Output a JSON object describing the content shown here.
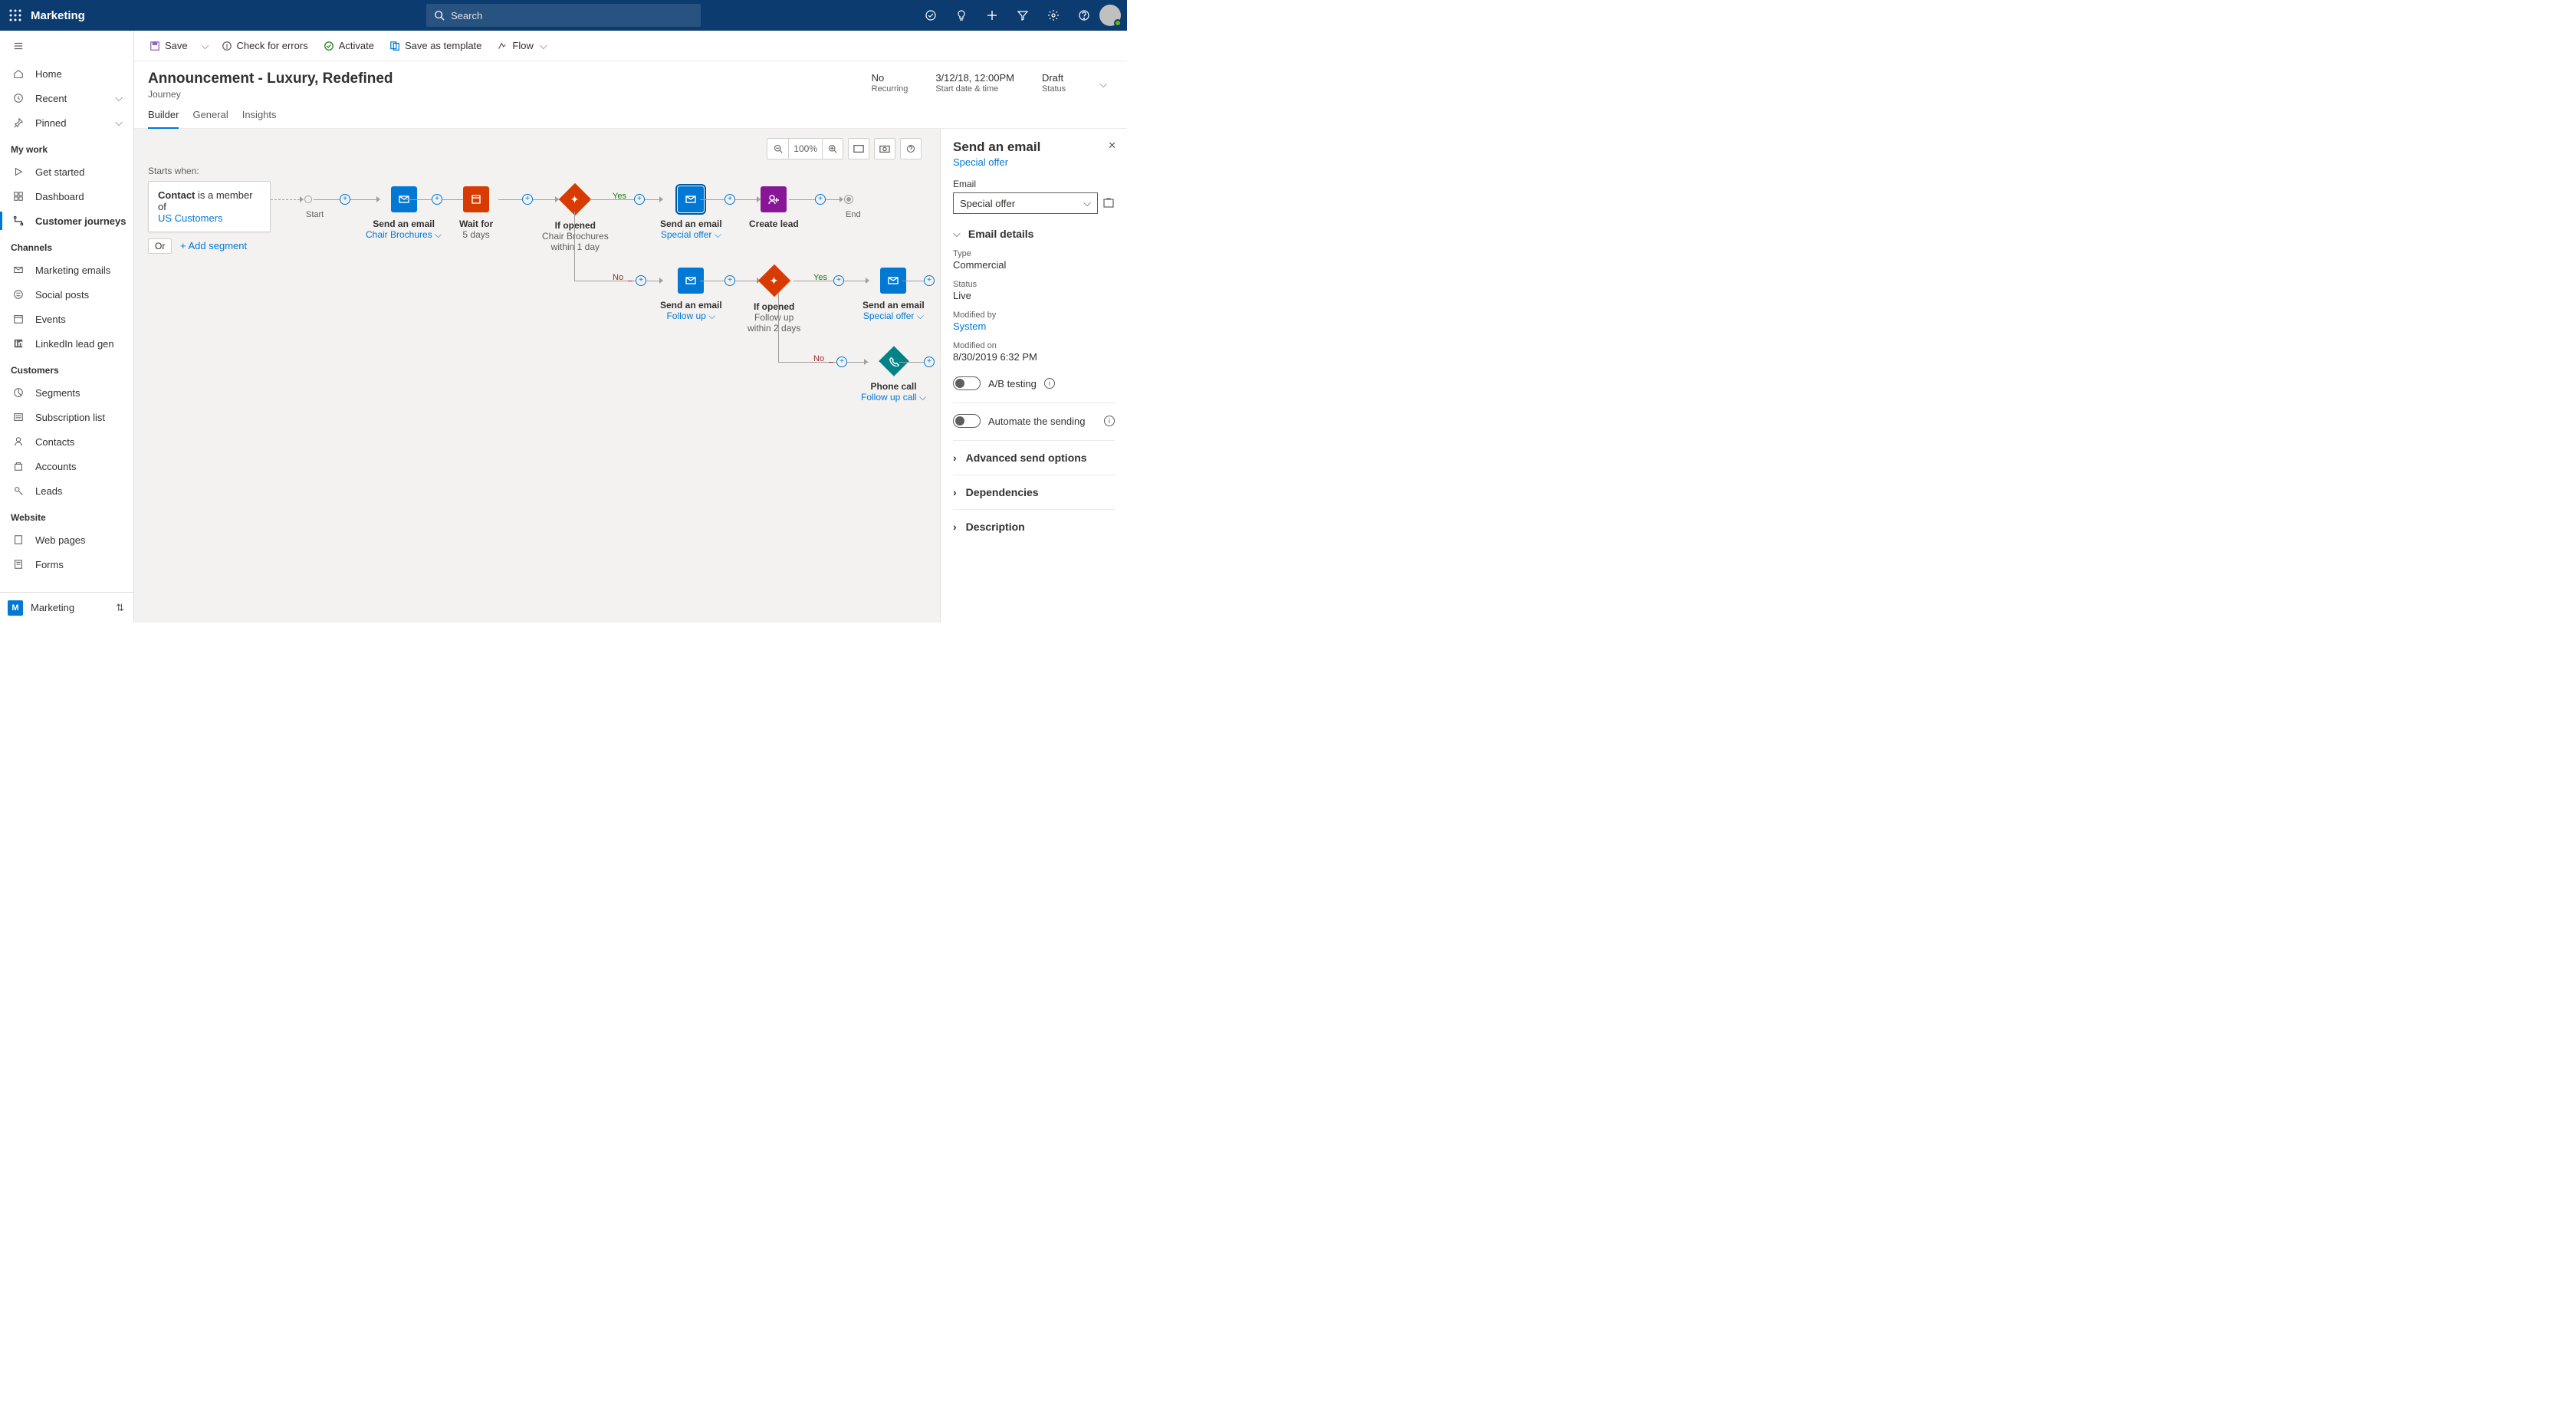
{
  "topbar": {
    "brand": "Marketing",
    "search_placeholder": "Search"
  },
  "nav": {
    "top": [
      {
        "icon": "home",
        "label": "Home"
      },
      {
        "icon": "clock",
        "label": "Recent",
        "chev": true
      },
      {
        "icon": "pin",
        "label": "Pinned",
        "chev": true
      }
    ],
    "sections": {
      "my_work": {
        "title": "My work",
        "items": [
          {
            "icon": "play",
            "label": "Get started"
          },
          {
            "icon": "dashboard",
            "label": "Dashboard"
          },
          {
            "icon": "journey",
            "label": "Customer journeys",
            "active": true
          }
        ]
      },
      "channels": {
        "title": "Channels",
        "items": [
          {
            "icon": "mail",
            "label": "Marketing emails"
          },
          {
            "icon": "social",
            "label": "Social posts"
          },
          {
            "icon": "event",
            "label": "Events"
          },
          {
            "icon": "linkedin",
            "label": "LinkedIn lead gen"
          }
        ]
      },
      "customers": {
        "title": "Customers",
        "items": [
          {
            "icon": "segment",
            "label": "Segments"
          },
          {
            "icon": "list",
            "label": "Subscription list"
          },
          {
            "icon": "contact",
            "label": "Contacts"
          },
          {
            "icon": "account",
            "label": "Accounts"
          },
          {
            "icon": "lead",
            "label": "Leads"
          }
        ]
      },
      "website": {
        "title": "Website",
        "items": [
          {
            "icon": "page",
            "label": "Web pages"
          },
          {
            "icon": "form",
            "label": "Forms"
          }
        ]
      }
    },
    "app_switcher": {
      "tile": "M",
      "label": "Marketing"
    }
  },
  "cmdbar": {
    "save": "Save",
    "check": "Check for errors",
    "activate": "Activate",
    "save_template": "Save as template",
    "flow": "Flow"
  },
  "header": {
    "title": "Announcement - Luxury, Redefined",
    "subtitle": "Journey",
    "meta": [
      {
        "value": "No",
        "label": "Recurring"
      },
      {
        "value": "3/12/18, 12:00PM",
        "label": "Start date & time"
      },
      {
        "value": "Draft",
        "label": "Status"
      }
    ]
  },
  "tabs": [
    "Builder",
    "General",
    "Insights"
  ],
  "canvas": {
    "zoom": "100%",
    "starts_when": "Starts when:",
    "segment_contact": "Contact",
    "segment_member": " is a member of ",
    "segment_link": "US Customers",
    "or": "Or",
    "add_segment": "+ Add segment",
    "start": "Start",
    "end": "End",
    "yes": "Yes",
    "no": "No",
    "nodes": {
      "email1": {
        "title": "Send an email",
        "link": "Chair Brochures"
      },
      "wait1": {
        "title": "Wait for",
        "sub": "5 days"
      },
      "if1": {
        "title": "If opened",
        "sub1": "Chair Brochures",
        "sub2": "within 1 day"
      },
      "email2": {
        "title": "Send an email",
        "link": "Special offer"
      },
      "lead": {
        "title": "Create lead"
      },
      "email3": {
        "title": "Send an email",
        "link": "Follow up"
      },
      "if2": {
        "title": "If opened",
        "sub1": "Follow up",
        "sub2": "within 2 days"
      },
      "email4": {
        "title": "Send an email",
        "link": "Special offer"
      },
      "call": {
        "title": "Phone call",
        "link": "Follow up call"
      }
    }
  },
  "rpanel": {
    "title": "Send an email",
    "link": "Special offer",
    "email_label": "Email",
    "email_value": "Special offer",
    "details_title": "Email details",
    "type_label": "Type",
    "type_value": "Commercial",
    "status_label": "Status",
    "status_value": "Live",
    "modified_by_label": "Modified by",
    "modified_by_value": "System",
    "modified_on_label": "Modified on",
    "modified_on_value": "8/30/2019  6:32 PM",
    "ab_testing": "A/B testing",
    "automate": "Automate the sending",
    "advanced": "Advanced send options",
    "dependencies": "Dependencies",
    "description": "Description"
  }
}
